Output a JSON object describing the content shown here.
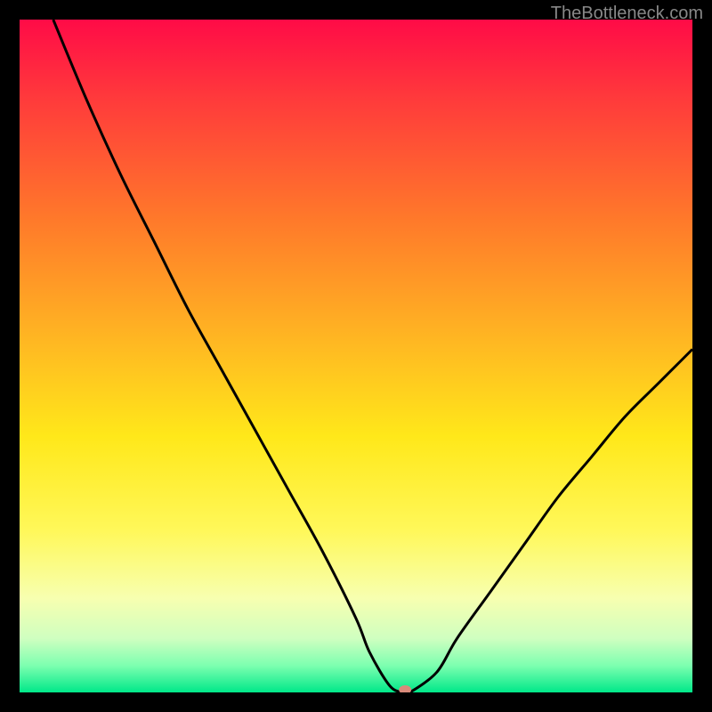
{
  "watermark": "TheBottleneck.com",
  "chart_data": {
    "type": "line",
    "title": "",
    "xlabel": "",
    "ylabel": "",
    "xlim": [
      0,
      100
    ],
    "ylim": [
      0,
      100
    ],
    "grid": false,
    "background_gradient": {
      "stops": [
        {
          "offset": 0.0,
          "color": "#ff0b47"
        },
        {
          "offset": 0.12,
          "color": "#ff3b3b"
        },
        {
          "offset": 0.3,
          "color": "#ff7a2a"
        },
        {
          "offset": 0.48,
          "color": "#ffb822"
        },
        {
          "offset": 0.62,
          "color": "#ffe81a"
        },
        {
          "offset": 0.76,
          "color": "#fff85a"
        },
        {
          "offset": 0.86,
          "color": "#f7ffb0"
        },
        {
          "offset": 0.92,
          "color": "#cfffc0"
        },
        {
          "offset": 0.96,
          "color": "#7dffb0"
        },
        {
          "offset": 1.0,
          "color": "#00e889"
        }
      ]
    },
    "series": [
      {
        "name": "bottleneck-curve",
        "color": "#000000",
        "x": [
          5,
          10,
          15,
          20,
          25,
          30,
          35,
          40,
          45,
          50,
          52,
          55,
          57,
          58,
          62,
          65,
          70,
          75,
          80,
          85,
          90,
          95,
          100
        ],
        "values": [
          100,
          88,
          77,
          67,
          57,
          48,
          39,
          30,
          21,
          11,
          6,
          1,
          0,
          0,
          3,
          8,
          15,
          22,
          29,
          35,
          41,
          46,
          51
        ]
      }
    ],
    "marker": {
      "name": "optimal-point",
      "x": 57.3,
      "y": 0,
      "color": "#d88a7a",
      "rx": 7,
      "ry": 5
    }
  }
}
